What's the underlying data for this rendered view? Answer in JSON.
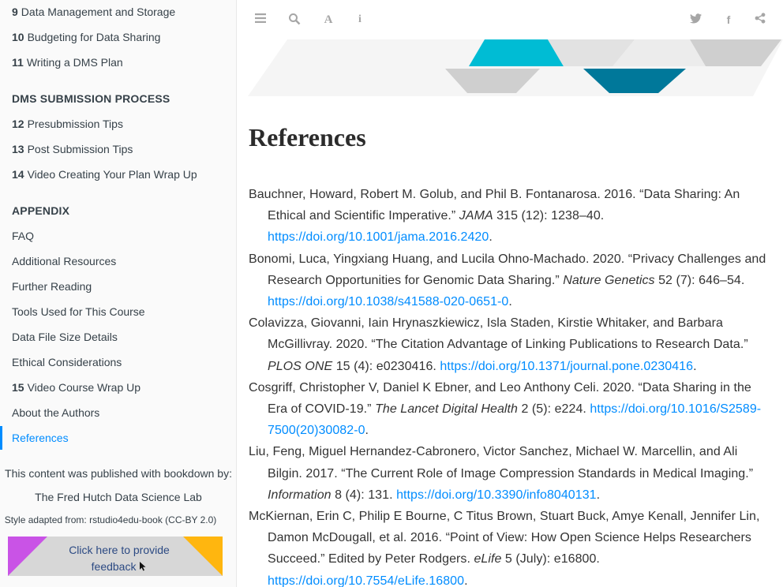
{
  "sidebar": {
    "chapters": [
      {
        "num": "9",
        "label": "Data Management and Storage"
      },
      {
        "num": "10",
        "label": "Budgeting for Data Sharing"
      },
      {
        "num": "11",
        "label": "Writing a DMS Plan"
      }
    ],
    "section_dms": "DMS SUBMISSION PROCESS",
    "dms_chapters": [
      {
        "num": "12",
        "label": "Presubmission Tips"
      },
      {
        "num": "13",
        "label": "Post Submission Tips"
      },
      {
        "num": "14",
        "label": "Video Creating Your Plan Wrap Up"
      }
    ],
    "section_appendix": "APPENDIX",
    "appendix_items": [
      {
        "num": "",
        "label": "FAQ"
      },
      {
        "num": "",
        "label": "Additional Resources"
      },
      {
        "num": "",
        "label": "Further Reading"
      },
      {
        "num": "",
        "label": "Tools Used for This Course"
      },
      {
        "num": "",
        "label": "Data File Size Details"
      },
      {
        "num": "",
        "label": "Ethical Considerations"
      },
      {
        "num": "15",
        "label": "Video Course Wrap Up"
      },
      {
        "num": "",
        "label": "About the Authors"
      },
      {
        "num": "",
        "label": "References"
      }
    ],
    "published_by": "This content was published with bookdown by:",
    "lab": "The Fred Hutch Data Science Lab",
    "style_adapted": "Style adapted from: rstudio4edu-book (CC-BY 2.0)",
    "feedback_label": "Click here to provide feedback"
  },
  "toolbar": {
    "icons": [
      "sidebar-toggle-icon",
      "search-icon",
      "font-settings-icon",
      "info-icon",
      "twitter-icon",
      "facebook-icon",
      "share-icon"
    ]
  },
  "colors": {
    "accent": "#008cff",
    "feedback_purple": "#c953e6",
    "feedback_orange": "#ffb60f",
    "banner_teal": "#00bcd4",
    "banner_dark_teal": "#00789a"
  },
  "page": {
    "title": "References",
    "references": [
      {
        "text": "Bauchner, Howard, Robert M. Golub, and Phil B. Fontanarosa. 2016. “Data Sharing: An Ethical and Scientific Imperative.” ",
        "journal": "JAMA",
        "rest": " 315 (12): 1238–40. ",
        "link": "https://doi.org/10.1001/jama.2016.2420"
      },
      {
        "text": "Bonomi, Luca, Yingxiang Huang, and Lucila Ohno-Machado. 2020. “Privacy Challenges and Research Opportunities for Genomic Data Sharing.” ",
        "journal": "Nature Genetics",
        "rest": " 52 (7): 646–54. ",
        "link": "https://doi.org/10.1038/s41588-020-0651-0"
      },
      {
        "text": "Colavizza, Giovanni, Iain Hrynaszkiewicz, Isla Staden, Kirstie Whitaker, and Barbara McGillivray. 2020. “The Citation Advantage of Linking Publications to Research Data.” ",
        "journal": "PLOS ONE",
        "rest": " 15 (4): e0230416. ",
        "link": "https://doi.org/10.1371/journal.pone.0230416"
      },
      {
        "text": "Cosgriff, Christopher V, Daniel K Ebner, and Leo Anthony Celi. 2020. “Data Sharing in the Era of COVID-19.” ",
        "journal": "The Lancet Digital Health",
        "rest": " 2 (5): e224. ",
        "link": "https://doi.org/10.1016/S2589-7500(20)30082-0"
      },
      {
        "text": "Liu, Feng, Miguel Hernandez-Cabronero, Victor Sanchez, Michael W. Marcellin, and Ali Bilgin. 2017. “The Current Role of Image Compression Standards in Medical Imaging.” ",
        "journal": "Information",
        "rest": " 8 (4): 131. ",
        "link": "https://doi.org/10.3390/info8040131"
      },
      {
        "text": "McKiernan, Erin C, Philip E Bourne, C Titus Brown, Stuart Buck, Amye Kenall, Jennifer Lin, Damon McDougall, et al. 2016. “Point of View: How Open Science Helps Researchers Succeed.” Edited by Peter Rodgers. ",
        "journal": "eLife",
        "rest": " 5 (July): e16800. ",
        "link": "https://doi.org/10.7554/eLife.16800"
      }
    ]
  }
}
